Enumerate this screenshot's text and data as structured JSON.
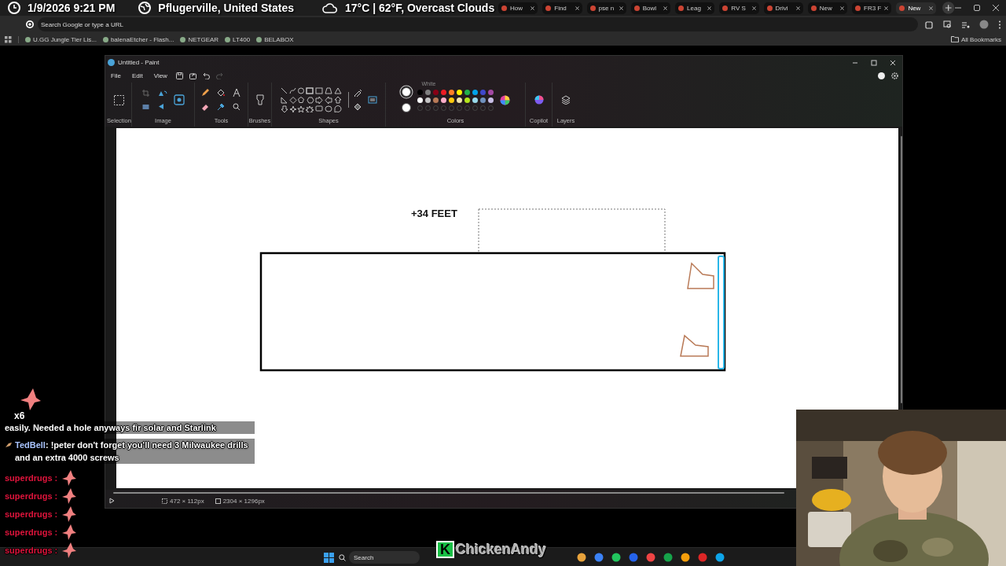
{
  "stream_overlay": {
    "date_time": "1/9/2026 9:21 PM",
    "location": "Pflugerville, United States",
    "weather": "17°C | 62°F, Overcast Clouds"
  },
  "browser": {
    "tabs": [
      {
        "title": "How",
        "selected": false
      },
      {
        "title": "Find",
        "selected": false
      },
      {
        "title": "pse n",
        "selected": false
      },
      {
        "title": "Bowl",
        "selected": false
      },
      {
        "title": "Leag",
        "selected": false
      },
      {
        "title": "RV S",
        "selected": false
      },
      {
        "title": "Drivi",
        "selected": false
      },
      {
        "title": "New",
        "selected": false
      },
      {
        "title": "FR3 F",
        "selected": false
      },
      {
        "title": "New",
        "selected": true
      }
    ],
    "address_placeholder": "Search Google or type a URL",
    "bookmarks": [
      "U.GG Jungle Tier Lis...",
      "balenaEtcher - Flash...",
      "NETGEAR",
      "LT400",
      "BELABOX"
    ],
    "all_bookmarks": "All Bookmarks"
  },
  "paint": {
    "title": "Untitled - Paint",
    "menu": [
      "File",
      "Edit",
      "View"
    ],
    "groups": [
      "Selection",
      "Image",
      "Tools",
      "Brushes",
      "Shapes",
      "Colors",
      "Copilot",
      "Layers"
    ],
    "tooltip": "White",
    "active_colors": [
      {
        "color": "#ffffff",
        "selected": true
      },
      {
        "color": "#ffffff",
        "selected": false
      }
    ],
    "colors": [
      {
        "color": "#000000"
      },
      {
        "color": "#7f7f7f"
      },
      {
        "color": "#880015"
      },
      {
        "color": "#ed1c24"
      },
      {
        "color": "#ff7f27"
      },
      {
        "color": "#fff200"
      },
      {
        "color": "#22b14c"
      },
      {
        "color": "#00a2e8"
      },
      {
        "color": "#3f48cc"
      },
      {
        "color": "#a349a4"
      },
      {
        "color": "#ffffff"
      },
      {
        "color": "#c3c3c3"
      },
      {
        "color": "#b97a57"
      },
      {
        "color": "#ffaec9"
      },
      {
        "color": "#ffc90e"
      },
      {
        "color": "#efe4b0"
      },
      {
        "color": "#b5e61d"
      },
      {
        "color": "#99d9ea"
      },
      {
        "color": "#7092be"
      },
      {
        "color": "#c8bfe7"
      }
    ],
    "canvas_text": "+34 FEET",
    "selection_size": "472 × 112px",
    "canvas_size": "2304 × 1296px"
  },
  "chat": {
    "badge": "x6",
    "messages": [
      {
        "kind": "continuation",
        "text": "easily. Needed a hole anyways fir solar and Starlink"
      },
      {
        "kind": "message",
        "user": "TedBell",
        "color": "#a9c4ff",
        "separator": ":",
        "text": "!peter don't forget you'll need 3 Milwaukee drills and an extra 4000 screws"
      },
      {
        "kind": "emote",
        "user": "superdrugs",
        "color": "#e0143c",
        "separator": ":"
      },
      {
        "kind": "emote",
        "user": "superdrugs",
        "color": "#e0143c",
        "separator": ":"
      },
      {
        "kind": "emote",
        "user": "superdrugs",
        "color": "#e0143c",
        "separator": ":"
      },
      {
        "kind": "emote",
        "user": "superdrugs",
        "color": "#e0143c",
        "separator": ":"
      },
      {
        "kind": "emote",
        "user": "superdrugs",
        "color": "#e0143c",
        "separator": ":"
      }
    ]
  },
  "taskbar": {
    "search_placeholder": "Search"
  },
  "streamer_logo": {
    "badge": "K",
    "name": "ChickenAndy"
  }
}
